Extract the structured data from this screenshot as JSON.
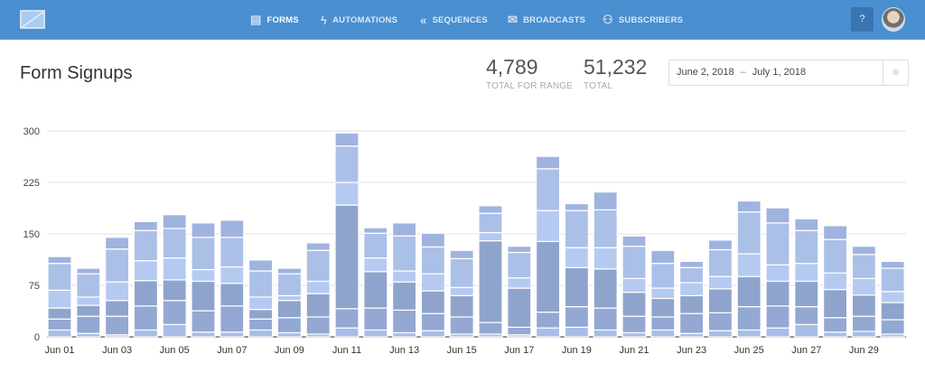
{
  "header": {
    "logo": "envelope-chart-logo",
    "nav": [
      {
        "label": "FORMS",
        "icon": "form-icon",
        "active": true
      },
      {
        "label": "AUTOMATIONS",
        "icon": "lightning-icon"
      },
      {
        "label": "SEQUENCES",
        "icon": "sequence-arrows-icon"
      },
      {
        "label": "BROADCASTS",
        "icon": "envelope-icon"
      },
      {
        "label": "SUBSCRIBERS",
        "icon": "people-icon"
      }
    ],
    "help_label": "?",
    "avatar": "user-avatar"
  },
  "page": {
    "title": "Form Signups",
    "stats": [
      {
        "value": "4,789",
        "label": "TOTAL FOR RANGE"
      },
      {
        "value": "51,232",
        "label": "TOTAL"
      }
    ],
    "date_range": {
      "start": "June 2, 2018",
      "separator": "–",
      "end": "July 1, 2018",
      "menu_icon": "lines-icon"
    }
  },
  "chart_data": {
    "type": "bar",
    "stacked": true,
    "ylim": [
      0,
      300
    ],
    "yticks": [
      0,
      75,
      150,
      225,
      300
    ],
    "grid": true,
    "categories": [
      "Jun 01",
      "Jun 02",
      "Jun 03",
      "Jun 04",
      "Jun 05",
      "Jun 06",
      "Jun 07",
      "Jun 08",
      "Jun 09",
      "Jun 10",
      "Jun 11",
      "Jun 12",
      "Jun 13",
      "Jun 14",
      "Jun 15",
      "Jun 16",
      "Jun 17",
      "Jun 18",
      "Jun 19",
      "Jun 20",
      "Jun 21",
      "Jun 22",
      "Jun 23",
      "Jun 24",
      "Jun 25",
      "Jun 26",
      "Jun 27",
      "Jun 28",
      "Jun 29",
      "Jun 30"
    ],
    "xtick_labels": [
      "Jun 01",
      "Jun 03",
      "Jun 05",
      "Jun 07",
      "Jun 09",
      "Jun 11",
      "Jun 13",
      "Jun 15",
      "Jun 17",
      "Jun 19",
      "Jun 21",
      "Jun 23",
      "Jun 25",
      "Jun 27",
      "Jun 29"
    ],
    "colors": [
      "#a8bde6",
      "#93a8d2",
      "#8ea4cc",
      "#b5caf1",
      "#abc0e7",
      "#9fb3df"
    ],
    "series": [
      {
        "values": [
          10,
          5,
          3,
          10,
          18,
          7,
          7,
          10,
          6,
          4,
          13,
          10,
          6,
          9,
          4,
          4,
          3,
          13,
          14,
          10,
          6,
          10,
          5,
          9,
          10,
          13,
          18,
          7,
          8,
          4
        ]
      },
      {
        "values": [
          16,
          25,
          27,
          35,
          35,
          31,
          38,
          16,
          22,
          25,
          28,
          32,
          33,
          25,
          25,
          17,
          11,
          23,
          30,
          32,
          24,
          19,
          29,
          26,
          34,
          32,
          26,
          21,
          22,
          21
        ]
      },
      {
        "values": [
          16,
          16,
          23,
          37,
          30,
          43,
          33,
          14,
          25,
          34,
          151,
          53,
          41,
          33,
          31,
          119,
          57,
          103,
          57,
          57,
          35,
          27,
          26,
          35,
          44,
          36,
          37,
          41,
          31,
          25
        ]
      },
      {
        "values": [
          26,
          12,
          27,
          29,
          32,
          17,
          24,
          18,
          7,
          18,
          33,
          20,
          16,
          25,
          12,
          12,
          15,
          45,
          29,
          31,
          20,
          15,
          19,
          18,
          33,
          24,
          26,
          24,
          24,
          16
        ]
      },
      {
        "values": [
          39,
          34,
          48,
          44,
          43,
          47,
          43,
          38,
          32,
          45,
          53,
          36,
          51,
          39,
          42,
          28,
          37,
          61,
          54,
          55,
          47,
          36,
          22,
          39,
          61,
          61,
          48,
          49,
          35,
          34
        ]
      },
      {
        "values": [
          10,
          8,
          17,
          13,
          20,
          21,
          25,
          16,
          8,
          11,
          19,
          8,
          19,
          20,
          12,
          11,
          9,
          18,
          10,
          26,
          15,
          19,
          9,
          14,
          16,
          22,
          17,
          20,
          12,
          10
        ]
      }
    ]
  }
}
